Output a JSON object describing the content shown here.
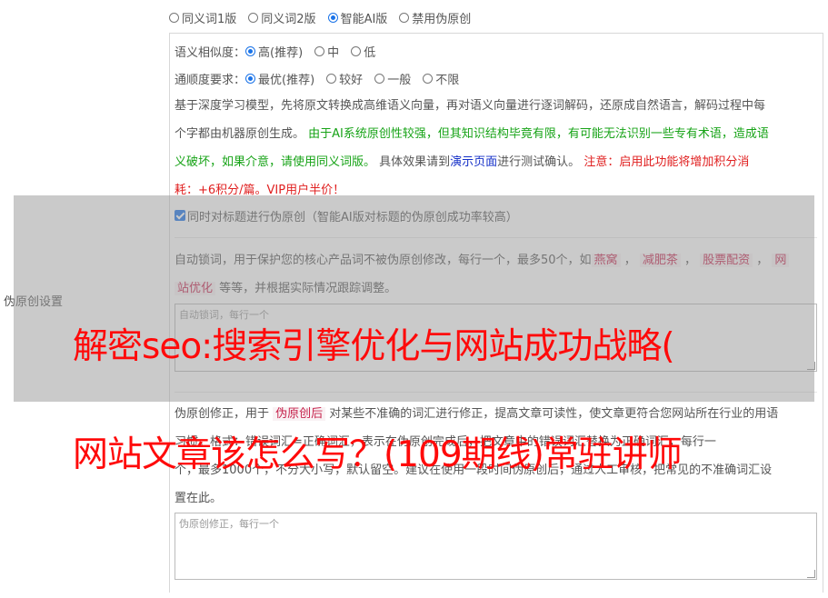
{
  "mode": {
    "options": [
      "同义词1版",
      "同义词2版",
      "智能AI版",
      "禁用伪原创"
    ],
    "selected": 2
  },
  "sidebar": {
    "label": "伪原创设置"
  },
  "similarity": {
    "label": "语义相似度：",
    "options": [
      "高(推荐)",
      "中",
      "低"
    ],
    "selected": 0
  },
  "fluency": {
    "label": "通顺度要求：",
    "options": [
      "最优(推荐)",
      "较好",
      "一般",
      "不限"
    ],
    "selected": 0
  },
  "description": {
    "line1": "基于深度学习模型，先将原文转换成高维语义向量，再对语义向量进行逐词解码，还原成自然语言，解码过程中每",
    "line2a": "个字都由机器原创生成。 ",
    "line2b": "由于AI系统原创性较强，但其知识结构毕竟有限，有可能无法识别一些专有术语，造成语",
    "line3a": "义破坏，如果介意，请使用同义词版。",
    "line3b": " 具体效果请到",
    "line3c": "演示页面",
    "line3d": "进行测试确认。 ",
    "line3e": "注意：启用此功能将增加积分消",
    "line4": "耗：+6积分/篇。VIP用户半价！"
  },
  "title_option": {
    "label": "同时对标题进行伪原创（智能AI版对标题的伪原创成功率较高）",
    "checked": true
  },
  "lock_words": {
    "text1": "自动锁词，用于保护您的核心产品词不被伪原创修改，每行一个，最多50个，如",
    "examples": [
      "燕窝",
      "减肥茶",
      "股票配资",
      "网"
    ],
    "example_cont": "站优化",
    "text2": " 等等，并根据实际情况跟踪调整。",
    "placeholder": "自动锁词，每行一个"
  },
  "correction": {
    "text1": "伪原创修正，用于 ",
    "keyword": "伪原创后",
    "text1b": " 对某些不准确的词汇进行修正，提高文章可读性，使文章更符合您网站所在行业的用语",
    "line2": "习惯。格式：错误词汇=正确词汇，表示在伪原创完成后，把文章中的错误词汇替换为正确词汇，每行一",
    "line3": "个，最多1000个，不分大小写，默认留空。建议在使用一段时间伪原创后，通过人工审核，把常见的不准确词汇设",
    "line4": "置在此。",
    "placeholder": "伪原创修正，每行一个"
  },
  "overlay": {
    "headline1": "解密seo:搜索引擎优化与网站成功战略(",
    "headline2": "网站文章该怎么写？(109期线)常驻讲师"
  }
}
